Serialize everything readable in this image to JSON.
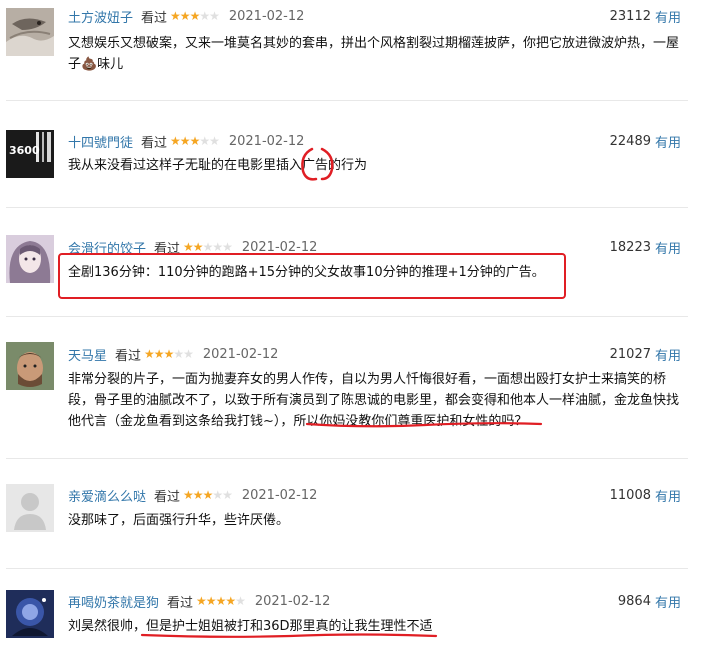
{
  "reviews": [
    {
      "name": "土方波妞子",
      "watched": "看过",
      "rating": 3,
      "date": "2021-02-12",
      "votes": "23112",
      "useful": "有用",
      "text_lines": [
        "又想娱乐又想破案，又来一堆莫名其妙的套串，拼出个风格割裂过期榴莲披萨，你把它放进微波炉热，一屋",
        "子💩味儿"
      ]
    },
    {
      "name": "十四號門徒",
      "watched": "看过",
      "rating": 3,
      "date": "2021-02-12",
      "votes": "22489",
      "useful": "有用",
      "text_lines": [
        "我从来没看过这样子无耻的在电影里插入广告的行为"
      ],
      "avatar_text": "3600"
    },
    {
      "name": "会滑行的饺子",
      "watched": "看过",
      "rating": 2,
      "date": "2021-02-12",
      "votes": "18223",
      "useful": "有用",
      "text_lines": [
        "全剧136分钟：110分钟的跑路+15分钟的父女故事10分钟的推理+1分钟的广告。"
      ]
    },
    {
      "name": "天马星",
      "watched": "看过",
      "rating": 3,
      "date": "2021-02-12",
      "votes": "21027",
      "useful": "有用",
      "text_lines": [
        "非常分裂的片子，一面为抛妻弃女的男人作传，自以为男人忏悔很好看，一面想出殴打女护士来搞笑的桥",
        "段，骨子里的油腻改不了，以致于所有演员到了陈思诚的电影里，都会变得和他本人一样油腻，金龙鱼快找",
        "他代言（金龙鱼看到这条给我打钱~），所以你妈没教你们尊重医护和女性的吗？"
      ]
    },
    {
      "name": "亲爱滴么么哒",
      "watched": "看过",
      "rating": 3,
      "date": "2021-02-12",
      "votes": "11008",
      "useful": "有用",
      "text_lines": [
        "没那味了，后面强行升华，些许厌倦。"
      ]
    },
    {
      "name": "再喝奶茶就是狗",
      "watched": "看过",
      "rating": 4,
      "date": "2021-02-12",
      "votes": "9864",
      "useful": "有用",
      "text_lines": [
        "刘昊然很帅，但是护士姐姐被打和36D那里真的让我生理性不适"
      ]
    }
  ],
  "colors": {
    "link": "#3377aa",
    "star": "#f5a623",
    "annotation": "#e01e24"
  },
  "icons": {
    "star": "star-icon"
  }
}
